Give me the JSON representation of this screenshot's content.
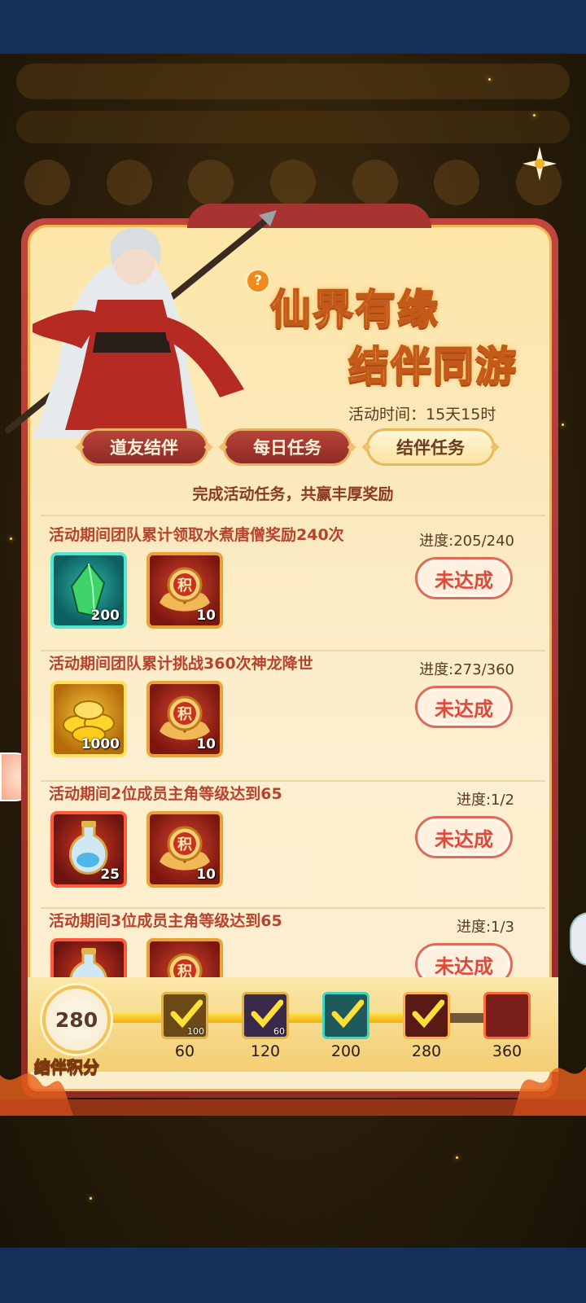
{
  "title": {
    "line1": "仙界有缘",
    "line2": "结伴同游",
    "help": "?"
  },
  "activity_time": "活动时间：15天15时",
  "tabs": [
    {
      "label": "道友结伴",
      "active": false
    },
    {
      "label": "每日任务",
      "active": false
    },
    {
      "label": "结伴任务",
      "active": true
    }
  ],
  "subtitle": "完成活动任务，共赢丰厚奖励",
  "tasks": [
    {
      "title": "活动期间团队累计领取水煮唐僧奖励240次",
      "progress": "进度:205/240",
      "button": "未达成",
      "rewards": [
        {
          "icon": "green-crystal-icon",
          "count": "200",
          "quality": "cyan"
        },
        {
          "icon": "score-token-icon",
          "count": "10",
          "glyph": "积"
        }
      ]
    },
    {
      "title": "活动期间团队累计挑战360次神龙降世",
      "progress": "进度:273/360",
      "button": "未达成",
      "rewards": [
        {
          "icon": "gold-ingots-icon",
          "count": "1000",
          "quality": "gold"
        },
        {
          "icon": "score-token-icon",
          "count": "10",
          "glyph": "积"
        }
      ]
    },
    {
      "title": "活动期间2位成员主角等级达到65",
      "progress": "进度:1/2",
      "button": "未达成",
      "rewards": [
        {
          "icon": "elixir-bottle-icon",
          "count": "25",
          "quality": "red"
        },
        {
          "icon": "score-token-icon",
          "count": "10",
          "glyph": "积"
        }
      ]
    },
    {
      "title": "活动期间3位成员主角等级达到65",
      "progress": "进度:1/3",
      "button": "未达成",
      "rewards": [
        {
          "icon": "elixir-bottle-icon",
          "count": "",
          "quality": "red"
        },
        {
          "icon": "score-token-icon",
          "count": "",
          "glyph": "积"
        }
      ]
    }
  ],
  "score": {
    "value": "280",
    "label": "结伴积分",
    "fraction_to_max": 0.75,
    "milestones": [
      {
        "value": "60",
        "count": "100",
        "claimed": true,
        "icon": "card-pack-icon"
      },
      {
        "value": "120",
        "count": "60",
        "claimed": true,
        "icon": "card-pack-icon"
      },
      {
        "value": "200",
        "count": "",
        "claimed": true,
        "icon": "card-pack-icon"
      },
      {
        "value": "280",
        "count": "",
        "claimed": true,
        "icon": "treasure-chest-icon"
      },
      {
        "value": "360",
        "count": "",
        "claimed": false,
        "icon": "portrait-reward-icon"
      }
    ]
  },
  "colors": {
    "accent_red": "#b7432e",
    "button_text": "#dd4a3a",
    "gold": "#f3b10f",
    "background": "#14305a"
  }
}
